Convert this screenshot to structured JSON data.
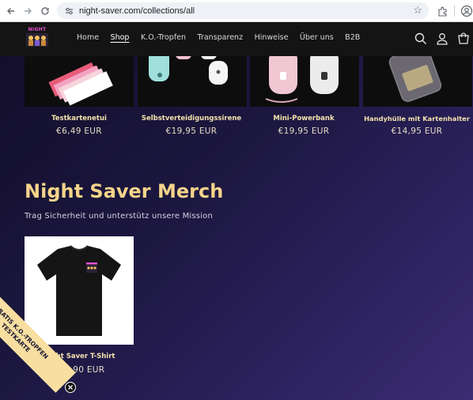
{
  "browser": {
    "url": "night-saver.com/collections/all",
    "back_icon": "arrow-left-icon",
    "forward_icon": "arrow-right-icon",
    "reload_icon": "reload-icon"
  },
  "site": {
    "logo_text": "NIGHT",
    "nav": [
      {
        "label": "Home"
      },
      {
        "label": "Shop",
        "active": true
      },
      {
        "label": "K.O.-Tropfen"
      },
      {
        "label": "Transparenz"
      },
      {
        "label": "Hinweise"
      },
      {
        "label": "Über uns"
      },
      {
        "label": "B2B"
      }
    ]
  },
  "products": [
    {
      "name": "Testkartenetui",
      "price": "€6,49 EUR"
    },
    {
      "name": "Selbstverteidigungssirene",
      "price": "€19,95 EUR"
    },
    {
      "name": "Mini-Powerbank",
      "price": "€19,95 EUR"
    },
    {
      "name": "Handyhülle mit Kartenhalter",
      "price": "€14,95 EUR"
    }
  ],
  "merch": {
    "title": "Night Saver Merch",
    "subtitle": "Trag Sicherheit und unterstütz unsere Mission",
    "items": [
      {
        "name": "Night Saver T-Shirt",
        "price": "€34,90 EUR"
      }
    ]
  },
  "promo": {
    "line1": "GRATIS K.O.-TROPFEN",
    "line2": "TESTKARTE"
  },
  "colors": {
    "accent": "#f5d48a",
    "header_bg": "#141414",
    "page_bg": "#1c1740"
  }
}
